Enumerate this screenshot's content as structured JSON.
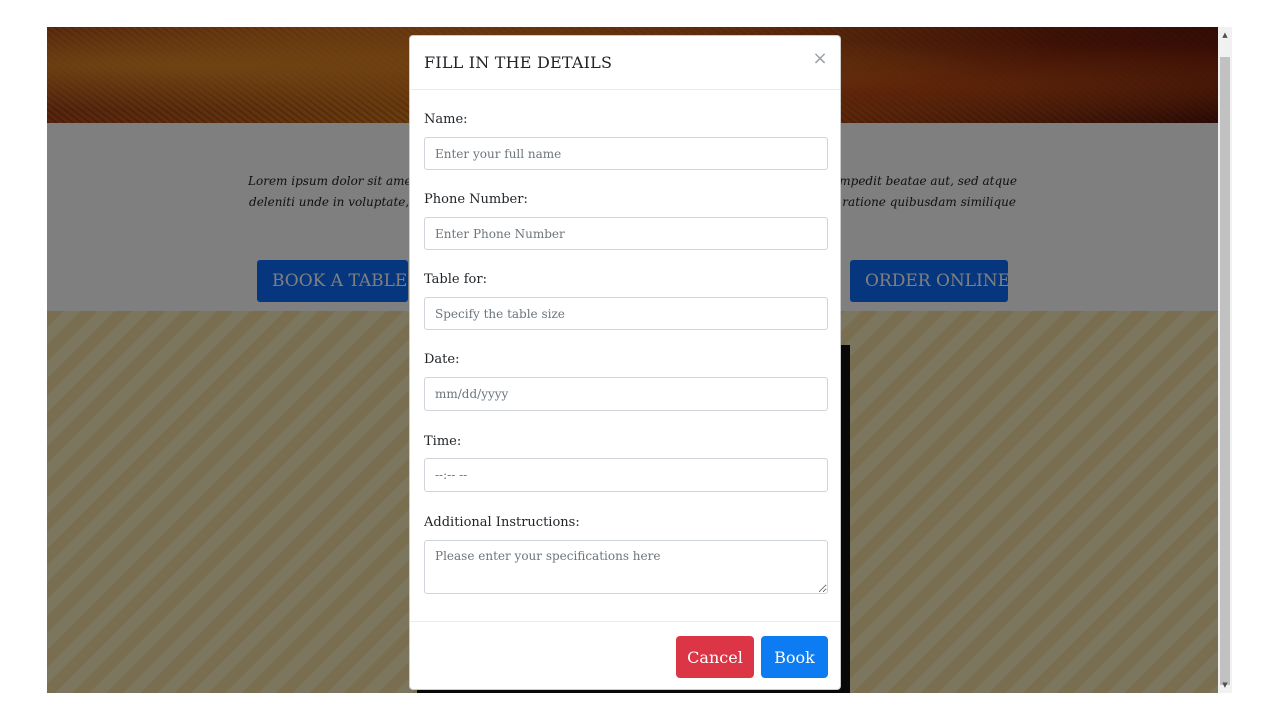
{
  "page": {
    "intro_line1": "Lorem ipsum dolor sit amet consectetur adipisicing elit. Quas, voluptatum nisi harum inventore impedit beatae aut, sed atque",
    "intro_line2": "deleniti unde in voluptate, libero neque. Quasi architecto reiciendis, asperiores numquam natus, ratione quibusdam similique odit ratione velit.",
    "book_table_label": "BOOK A TABLE",
    "order_online_label": "ORDER ONLINE"
  },
  "modal": {
    "title": "FILL IN THE DETAILS",
    "close_symbol": "×",
    "fields": {
      "name": {
        "label": "Name:",
        "placeholder": "Enter your full name"
      },
      "phone": {
        "label": "Phone Number:",
        "placeholder": "Enter Phone Number"
      },
      "table": {
        "label": "Table for:",
        "placeholder": "Specify the table size"
      },
      "date": {
        "label": "Date:",
        "placeholder": "mm/dd/yyyy"
      },
      "time": {
        "label": "Time:",
        "placeholder": "--:-- --"
      },
      "instructions": {
        "label": "Additional Instructions:",
        "placeholder": "Please enter your specifications here"
      }
    },
    "cancel_label": "Cancel",
    "book_label": "Book"
  },
  "colors": {
    "primary": "#0d6efd",
    "danger": "#dc3545",
    "overlay": "rgba(0,0,0,0.5)"
  },
  "icons": {
    "close": "close-icon",
    "scroll_up": "scroll-up-arrow-icon",
    "scroll_down": "scroll-down-arrow-icon",
    "resize": "resize-handle-icon"
  }
}
